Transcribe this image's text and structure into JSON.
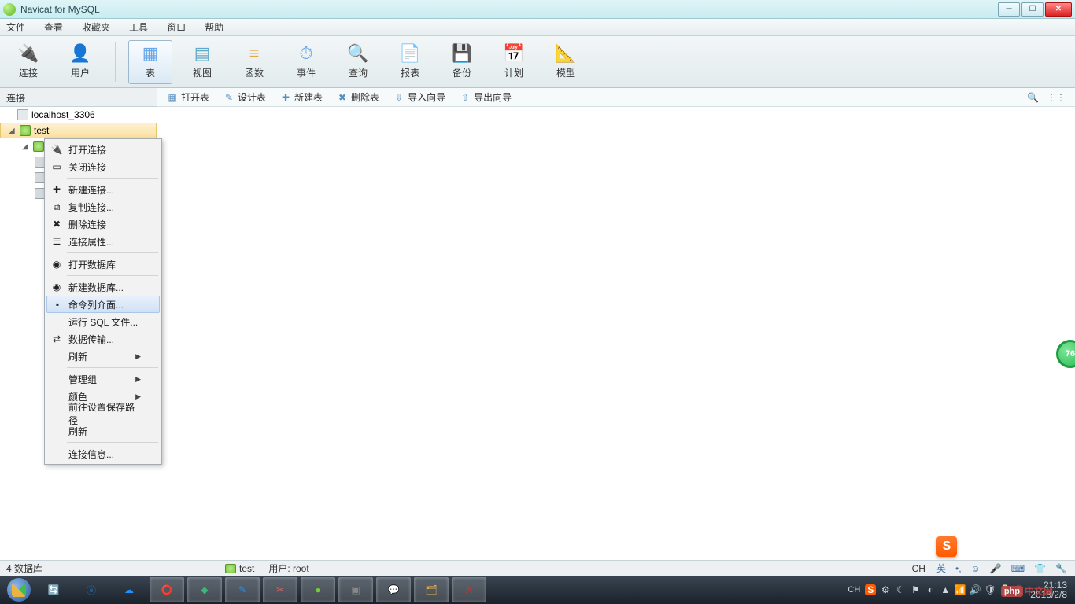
{
  "title": "Navicat for MySQL",
  "menubar": [
    "文件",
    "查看",
    "收藏夹",
    "工具",
    "窗口",
    "帮助"
  ],
  "toolbar": [
    {
      "label": "连接",
      "icon": "🔌",
      "color": "#4a8dd4"
    },
    {
      "label": "用户",
      "icon": "👤",
      "color": "#f0b84a"
    },
    {
      "sep": true
    },
    {
      "label": "表",
      "icon": "▦",
      "color": "#6aa6e8",
      "active": true
    },
    {
      "label": "视图",
      "icon": "▤",
      "color": "#5fa8c8"
    },
    {
      "label": "函数",
      "icon": "≡",
      "color": "#e5a742"
    },
    {
      "label": "事件",
      "icon": "⏱",
      "color": "#6aa6e8"
    },
    {
      "label": "查询",
      "icon": "🔍",
      "color": "#6aa6e8"
    },
    {
      "label": "报表",
      "icon": "📄",
      "color": "#e5a742"
    },
    {
      "label": "备份",
      "icon": "💾",
      "color": "#8d8d8d"
    },
    {
      "label": "计划",
      "icon": "📅",
      "color": "#6aa6e8"
    },
    {
      "label": "模型",
      "icon": "📐",
      "color": "#e5a742"
    }
  ],
  "sidebar_header": "连接",
  "subtoolbar": [
    {
      "label": "打开表",
      "icon": "▦"
    },
    {
      "label": "设计表",
      "icon": "✎"
    },
    {
      "label": "新建表",
      "icon": "✚"
    },
    {
      "label": "删除表",
      "icon": "✖"
    },
    {
      "label": "导入向导",
      "icon": "⇩"
    },
    {
      "label": "导出向导",
      "icon": "⇧"
    }
  ],
  "tree": {
    "server": "localhost_3306",
    "selected_db": "test"
  },
  "context_menu": {
    "groups": [
      [
        {
          "label": "打开连接",
          "icon": "🔌"
        },
        {
          "label": "关闭连接",
          "icon": "▭"
        }
      ],
      [
        {
          "label": "新建连接...",
          "icon": "✚"
        },
        {
          "label": "复制连接...",
          "icon": "⧉"
        },
        {
          "label": "删除连接",
          "icon": "✖"
        },
        {
          "label": "连接属性...",
          "icon": "☰"
        }
      ],
      [
        {
          "label": "打开数据库",
          "icon": "◉"
        }
      ],
      [
        {
          "label": "新建数据库...",
          "icon": "◉"
        },
        {
          "label": "命令列介面...",
          "icon": "▪",
          "highlight": true
        },
        {
          "label": "运行 SQL 文件...",
          "icon": ""
        },
        {
          "label": "数据传输...",
          "icon": "⇄"
        },
        {
          "label": "刷新",
          "submenu": true
        }
      ],
      [
        {
          "label": "管理组",
          "submenu": true
        },
        {
          "label": "颜色",
          "submenu": true
        },
        {
          "label": "前往设置保存路径"
        },
        {
          "label": "刷新"
        }
      ],
      [
        {
          "label": "连接信息..."
        }
      ]
    ]
  },
  "statusbar": {
    "left": "4 数据库",
    "center_db": "test",
    "center_user": "用户: root",
    "ime": "CH"
  },
  "float_badge": "76",
  "taskbar": {
    "items": [
      {
        "color": "",
        "emoji": ""
      },
      {
        "color": "#8cc",
        "emoji": "🔄"
      },
      {
        "color": "#1e73be",
        "emoji": "ⓔ"
      },
      {
        "color": "#1e90ff",
        "emoji": "☁"
      },
      {
        "active": true,
        "emoji": "⭕",
        "color": "#fff"
      },
      {
        "active": true,
        "emoji": "◆",
        "color": "#3b7"
      },
      {
        "active": true,
        "emoji": "✎",
        "color": "#1e90ff"
      },
      {
        "active": true,
        "emoji": "✂",
        "color": "#c66"
      },
      {
        "active": true,
        "emoji": "●",
        "color": "#7c3"
      },
      {
        "active": true,
        "emoji": "▣",
        "color": "#888"
      },
      {
        "active": true,
        "emoji": "💬",
        "color": "#3b3"
      },
      {
        "active": true,
        "emoji": "🗂",
        "color": "#e8b24a"
      },
      {
        "active": true,
        "emoji": "A",
        "color": "#c33",
        "bg": "#c33"
      }
    ],
    "tray_icons": [
      "S",
      "⚙",
      "☾",
      "⚑",
      "◐",
      "▲",
      "📶",
      "🔊",
      "🛡",
      "🔋",
      "🐧"
    ],
    "clock_time": "21:13",
    "clock_date": "2018/2/8"
  },
  "watermark": {
    "tag": "php",
    "text": "中文网"
  },
  "sogou": "S"
}
